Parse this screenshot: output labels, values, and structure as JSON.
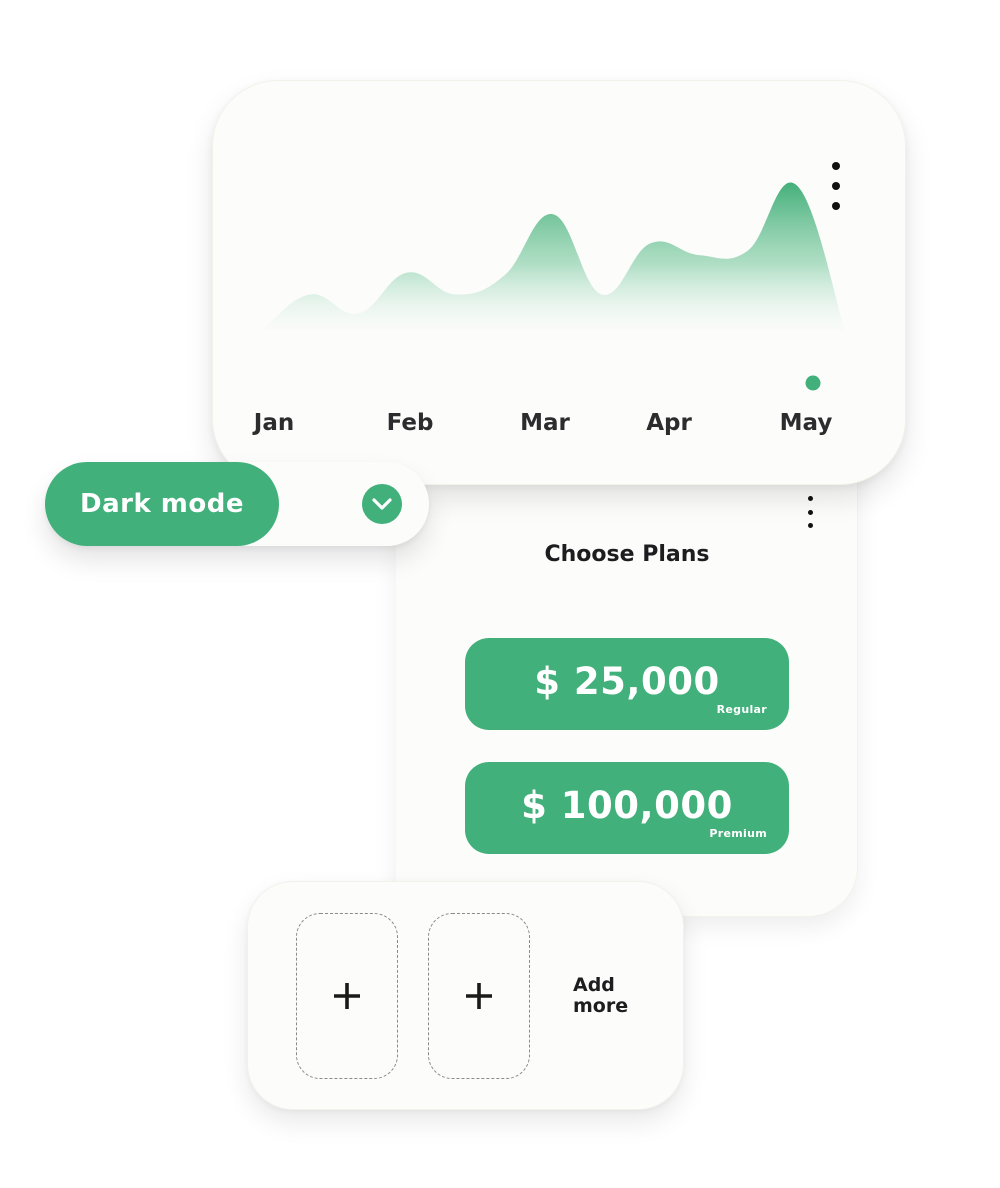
{
  "colors": {
    "accent": "#41b07b",
    "card_background": "#fcfcfb",
    "text_dark": "#1d1d1f",
    "area_gradient_top": "#3aab73"
  },
  "chart_data": {
    "type": "area",
    "title": "",
    "xlabel": "",
    "ylabel": "",
    "categories": [
      "Jan",
      "Feb",
      "Mar",
      "Apr",
      "May"
    ],
    "x": [
      0,
      0.35,
      0.7,
      1.05,
      1.4,
      1.75,
      2.1,
      2.45,
      2.8,
      3.15,
      3.5,
      3.85,
      4.2
    ],
    "values": [
      0,
      0.25,
      0.12,
      0.4,
      0.25,
      0.38,
      0.8,
      0.25,
      0.6,
      0.52,
      0.55,
      1.0,
      0.0
    ],
    "grid": false,
    "legend": "none",
    "highlighted_category": "May",
    "highlight_icon": "dot-marker"
  },
  "chart_card": {
    "menu_icon": "kebab-menu-icon"
  },
  "toggle": {
    "label": "Dark mode",
    "icon": "chevron-down-icon"
  },
  "plans": {
    "title": "Choose Plans",
    "menu_icon": "kebab-menu-icon",
    "items": [
      {
        "price": "$ 25,000",
        "tier": "Regular"
      },
      {
        "price": "$ 100,000",
        "tier": "Premium"
      }
    ]
  },
  "add_more": {
    "slot_icon": "plus-icon",
    "label_line1": "Add",
    "label_line2": "more"
  }
}
